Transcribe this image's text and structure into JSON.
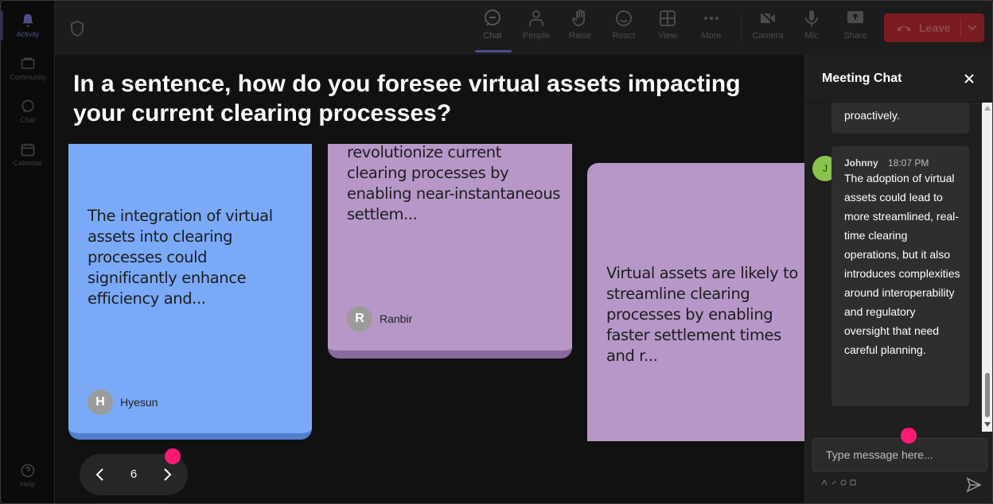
{
  "rail": {
    "items": [
      {
        "label": "Activity",
        "icon": "bell-icon"
      },
      {
        "label": "Community",
        "icon": "community-icon"
      },
      {
        "label": "Chat",
        "icon": "chat-icon"
      },
      {
        "label": "Calendar",
        "icon": "calendar-icon"
      }
    ],
    "help": "Help"
  },
  "toolbar": {
    "chat": "Chat",
    "people": "People",
    "raise": "Raise",
    "react": "React",
    "view": "View",
    "more": "More",
    "camera": "Camera",
    "mic": "Mic",
    "share": "Share",
    "leave": "Leave"
  },
  "question": "In a sentence, how do you foresee virtual assets impacting your current clearing processes?",
  "cards": [
    {
      "text": "The integration of virtual assets into clearing processes could significantly enhance efficiency and...",
      "author": "Hyesun",
      "initial": "H",
      "color": "#7aaaf7"
    },
    {
      "text": "revolutionize current clearing processes by enabling near-instantaneous settlem...",
      "author": "Ranbir",
      "initial": "R",
      "color": "#b797c8"
    },
    {
      "text": "Virtual assets are likely to streamline clearing processes by enabling faster settlement times and r...",
      "color": "#b797c8"
    }
  ],
  "pager": {
    "page": "6"
  },
  "chat": {
    "title": "Meeting Chat",
    "prev_message_tail": "proactively.",
    "message": {
      "name": "Johnny",
      "time": "18:07 PM",
      "initial": "J",
      "body": "The adoption of virtual assets could lead to more streamlined, real-time clearing operations, but it also introduces complexities around interoperability and regulatory oversight that need careful planning."
    },
    "input_placeholder": "Type message here..."
  },
  "colors": {
    "accent": "#5b5fc7",
    "leave": "#c4314b",
    "cursor_dot": "#ff1a75",
    "avatar_green": "#8bc34a"
  }
}
